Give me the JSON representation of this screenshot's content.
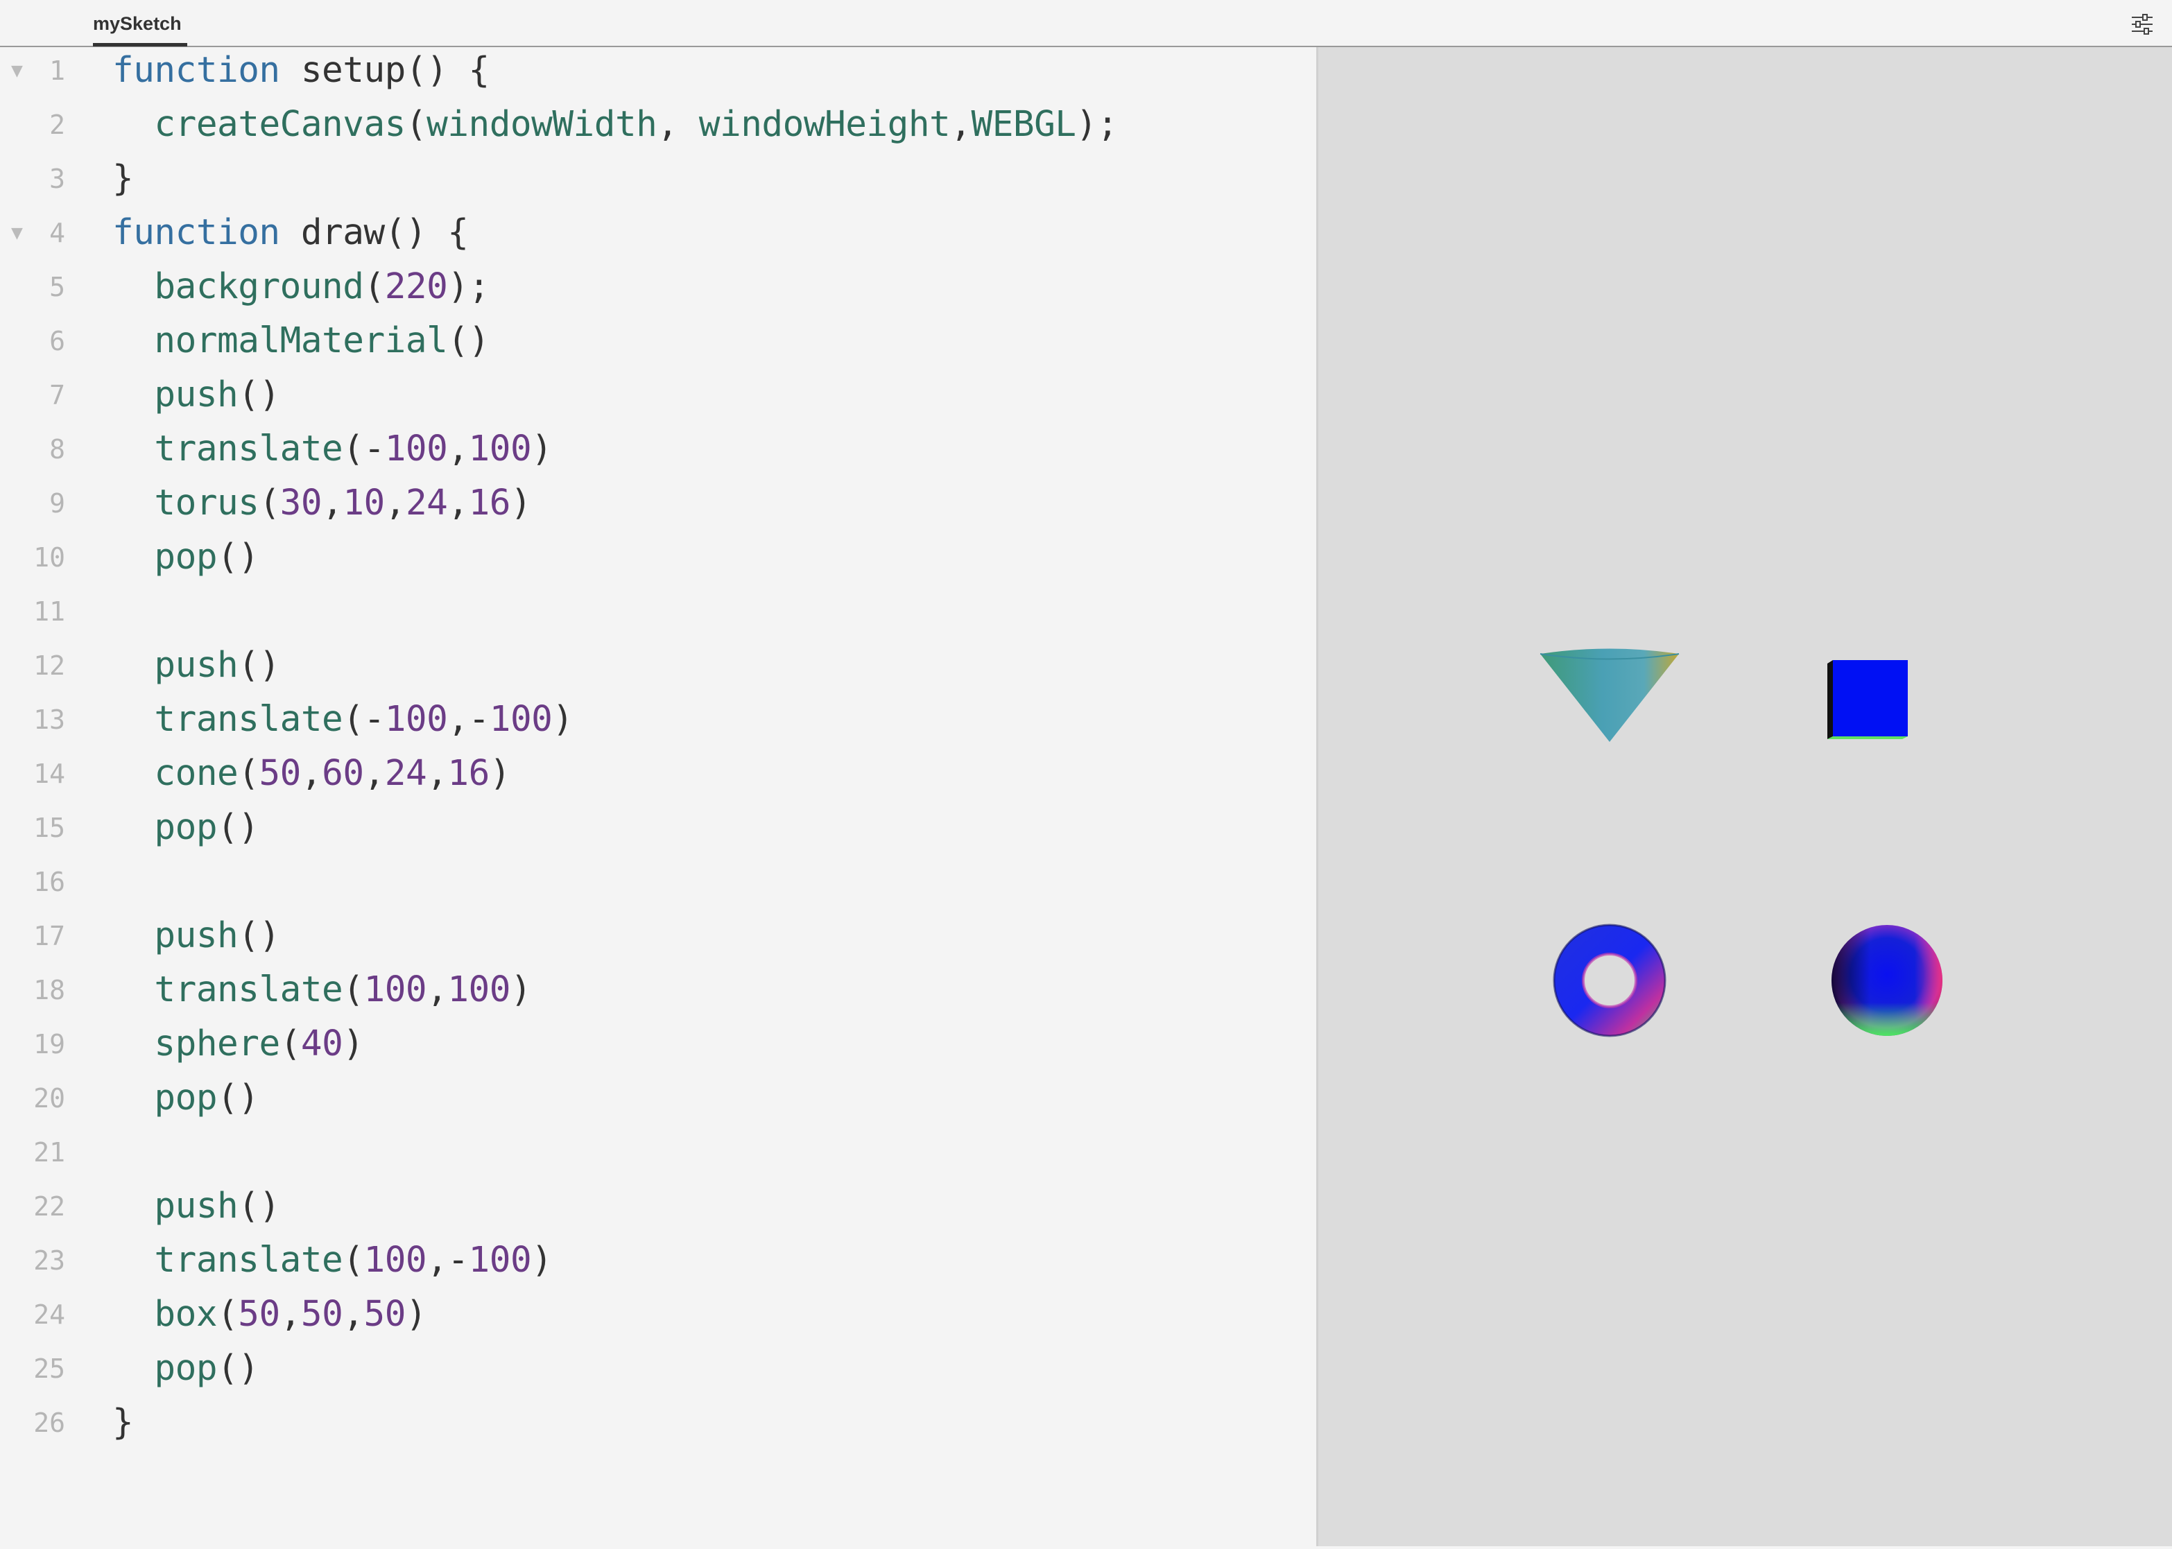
{
  "window": {
    "tab_title": "mySketch",
    "settings_icon": "sliders-icon"
  },
  "code": {
    "lines": [
      {
        "n": "1",
        "fold": true,
        "tokens": [
          [
            "kw",
            "function"
          ],
          [
            "pl",
            " setup() {"
          ]
        ]
      },
      {
        "n": "2",
        "fold": false,
        "tokens": [
          [
            "pl",
            "  "
          ],
          [
            "fn",
            "createCanvas"
          ],
          [
            "pl",
            "("
          ],
          [
            "fn",
            "windowWidth"
          ],
          [
            "pl",
            ", "
          ],
          [
            "fn",
            "windowHeight"
          ],
          [
            "pl",
            ","
          ],
          [
            "fn",
            "WEBGL"
          ],
          [
            "pl",
            ");"
          ]
        ]
      },
      {
        "n": "3",
        "fold": false,
        "tokens": [
          [
            "pl",
            "}"
          ]
        ]
      },
      {
        "n": "4",
        "fold": true,
        "tokens": [
          [
            "kw",
            "function"
          ],
          [
            "pl",
            " draw() {"
          ]
        ]
      },
      {
        "n": "5",
        "fold": false,
        "tokens": [
          [
            "pl",
            "  "
          ],
          [
            "fn",
            "background"
          ],
          [
            "pl",
            "("
          ],
          [
            "num",
            "220"
          ],
          [
            "pl",
            ");"
          ]
        ]
      },
      {
        "n": "6",
        "fold": false,
        "tokens": [
          [
            "pl",
            "  "
          ],
          [
            "fn",
            "normalMaterial"
          ],
          [
            "pl",
            "()"
          ]
        ]
      },
      {
        "n": "7",
        "fold": false,
        "tokens": [
          [
            "pl",
            "  "
          ],
          [
            "fn",
            "push"
          ],
          [
            "pl",
            "()"
          ]
        ]
      },
      {
        "n": "8",
        "fold": false,
        "tokens": [
          [
            "pl",
            "  "
          ],
          [
            "fn",
            "translate"
          ],
          [
            "pl",
            "(-"
          ],
          [
            "num",
            "100"
          ],
          [
            "pl",
            ","
          ],
          [
            "num",
            "100"
          ],
          [
            "pl",
            ")"
          ]
        ]
      },
      {
        "n": "9",
        "fold": false,
        "tokens": [
          [
            "pl",
            "  "
          ],
          [
            "fn",
            "torus"
          ],
          [
            "pl",
            "("
          ],
          [
            "num",
            "30"
          ],
          [
            "pl",
            ","
          ],
          [
            "num",
            "10"
          ],
          [
            "pl",
            ","
          ],
          [
            "num",
            "24"
          ],
          [
            "pl",
            ","
          ],
          [
            "num",
            "16"
          ],
          [
            "pl",
            ")"
          ]
        ]
      },
      {
        "n": "10",
        "fold": false,
        "tokens": [
          [
            "pl",
            "  "
          ],
          [
            "fn",
            "pop"
          ],
          [
            "pl",
            "()"
          ]
        ]
      },
      {
        "n": "11",
        "fold": false,
        "tokens": []
      },
      {
        "n": "12",
        "fold": false,
        "tokens": [
          [
            "pl",
            "  "
          ],
          [
            "fn",
            "push"
          ],
          [
            "pl",
            "()"
          ]
        ]
      },
      {
        "n": "13",
        "fold": false,
        "tokens": [
          [
            "pl",
            "  "
          ],
          [
            "fn",
            "translate"
          ],
          [
            "pl",
            "(-"
          ],
          [
            "num",
            "100"
          ],
          [
            "pl",
            ",-"
          ],
          [
            "num",
            "100"
          ],
          [
            "pl",
            ")"
          ]
        ]
      },
      {
        "n": "14",
        "fold": false,
        "tokens": [
          [
            "pl",
            "  "
          ],
          [
            "fn",
            "cone"
          ],
          [
            "pl",
            "("
          ],
          [
            "num",
            "50"
          ],
          [
            "pl",
            ","
          ],
          [
            "num",
            "60"
          ],
          [
            "pl",
            ","
          ],
          [
            "num",
            "24"
          ],
          [
            "pl",
            ","
          ],
          [
            "num",
            "16"
          ],
          [
            "pl",
            ")"
          ]
        ]
      },
      {
        "n": "15",
        "fold": false,
        "tokens": [
          [
            "pl",
            "  "
          ],
          [
            "fn",
            "pop"
          ],
          [
            "pl",
            "()"
          ]
        ]
      },
      {
        "n": "16",
        "fold": false,
        "tokens": []
      },
      {
        "n": "17",
        "fold": false,
        "tokens": [
          [
            "pl",
            "  "
          ],
          [
            "fn",
            "push"
          ],
          [
            "pl",
            "()"
          ]
        ]
      },
      {
        "n": "18",
        "fold": false,
        "tokens": [
          [
            "pl",
            "  "
          ],
          [
            "fn",
            "translate"
          ],
          [
            "pl",
            "("
          ],
          [
            "num",
            "100"
          ],
          [
            "pl",
            ","
          ],
          [
            "num",
            "100"
          ],
          [
            "pl",
            ")"
          ]
        ]
      },
      {
        "n": "19",
        "fold": false,
        "tokens": [
          [
            "pl",
            "  "
          ],
          [
            "fn",
            "sphere"
          ],
          [
            "pl",
            "("
          ],
          [
            "num",
            "40"
          ],
          [
            "pl",
            ")"
          ]
        ]
      },
      {
        "n": "20",
        "fold": false,
        "tokens": [
          [
            "pl",
            "  "
          ],
          [
            "fn",
            "pop"
          ],
          [
            "pl",
            "()"
          ]
        ]
      },
      {
        "n": "21",
        "fold": false,
        "tokens": []
      },
      {
        "n": "22",
        "fold": false,
        "tokens": [
          [
            "pl",
            "  "
          ],
          [
            "fn",
            "push"
          ],
          [
            "pl",
            "()"
          ]
        ]
      },
      {
        "n": "23",
        "fold": false,
        "tokens": [
          [
            "pl",
            "  "
          ],
          [
            "fn",
            "translate"
          ],
          [
            "pl",
            "("
          ],
          [
            "num",
            "100"
          ],
          [
            "pl",
            ",-"
          ],
          [
            "num",
            "100"
          ],
          [
            "pl",
            ")"
          ]
        ]
      },
      {
        "n": "24",
        "fold": false,
        "tokens": [
          [
            "pl",
            "  "
          ],
          [
            "fn",
            "box"
          ],
          [
            "pl",
            "("
          ],
          [
            "num",
            "50"
          ],
          [
            "pl",
            ","
          ],
          [
            "num",
            "50"
          ],
          [
            "pl",
            ","
          ],
          [
            "num",
            "50"
          ],
          [
            "pl",
            ")"
          ]
        ]
      },
      {
        "n": "25",
        "fold": false,
        "tokens": [
          [
            "pl",
            "  "
          ],
          [
            "fn",
            "pop"
          ],
          [
            "pl",
            "()"
          ]
        ]
      },
      {
        "n": "26",
        "fold": false,
        "tokens": [
          [
            "pl",
            "}"
          ]
        ]
      }
    ]
  },
  "preview": {
    "background": "#dcdcdc",
    "shapes": [
      "cone",
      "box",
      "torus",
      "sphere"
    ]
  },
  "colors": {
    "keyword": "#356fa0",
    "function": "#2f6f5e",
    "number": "#6b3c86",
    "plain": "#333333",
    "line_number": "#b5b5b5"
  }
}
